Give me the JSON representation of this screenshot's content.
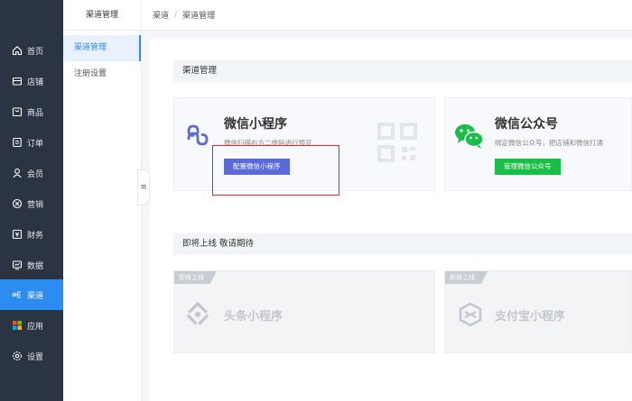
{
  "sidebar": {
    "items": [
      {
        "label": "首页"
      },
      {
        "label": "店铺"
      },
      {
        "label": "商品"
      },
      {
        "label": "订单"
      },
      {
        "label": "会员"
      },
      {
        "label": "营销"
      },
      {
        "label": "财务"
      },
      {
        "label": "数据"
      },
      {
        "label": "渠道"
      },
      {
        "label": "应用"
      },
      {
        "label": "设置"
      }
    ]
  },
  "subnav": {
    "title": "渠道管理",
    "items": [
      {
        "label": "渠道管理"
      },
      {
        "label": "注册设置"
      }
    ]
  },
  "breadcrumb": {
    "root": "渠道",
    "separator": "/",
    "current": "渠道管理"
  },
  "channel_section": {
    "title": "渠道管理",
    "miniprogram": {
      "name": "微信小程序",
      "desc": "微信扫描右方二维码进行预览",
      "button": "配置微信小程序"
    },
    "official_account": {
      "name": "微信公众号",
      "desc": "绑定微信公众号，把店铺和微信打通",
      "button": "管理微信公众号"
    }
  },
  "coming_section": {
    "title": "即将上线 敬请期待",
    "cards": [
      {
        "tag": "即将上线",
        "name": "头条小程序"
      },
      {
        "tag": "即将上线",
        "name": "支付宝小程序"
      }
    ]
  },
  "colors": {
    "sidebar_bg": "#2b3442",
    "accent": "#2d8cf0",
    "config_button": "#5b6bd6",
    "wechat_green": "#19be47",
    "highlight_border": "#e0242b"
  }
}
